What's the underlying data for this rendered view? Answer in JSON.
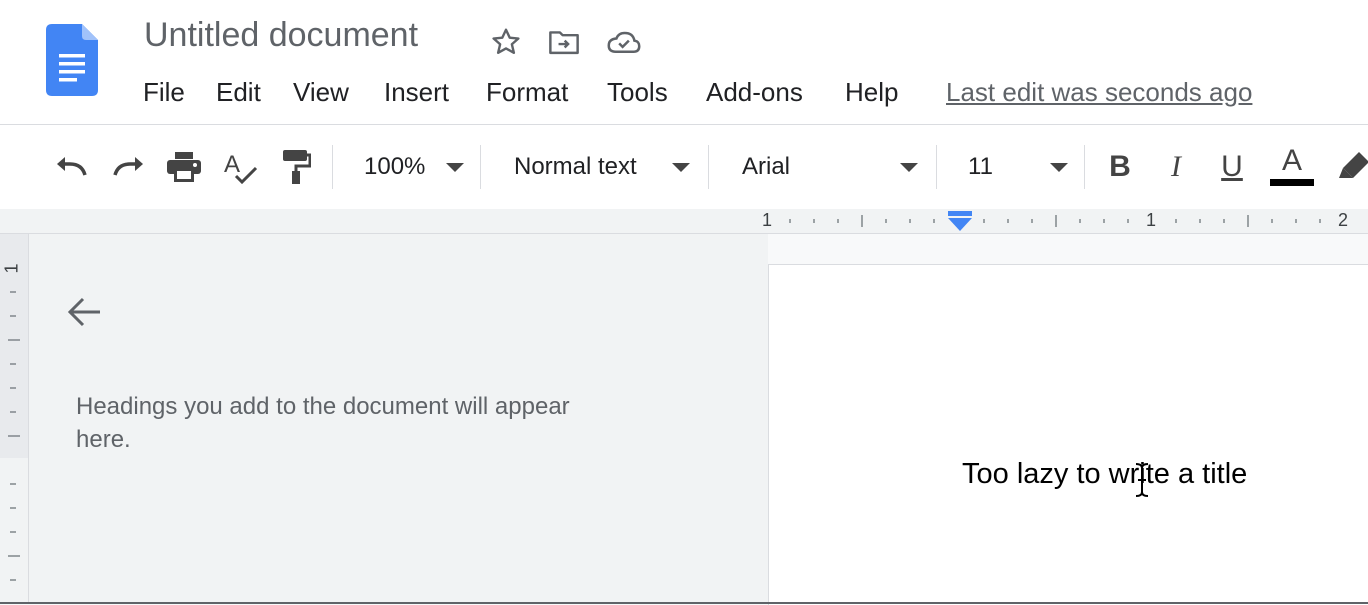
{
  "app": {
    "title": "Untitled document",
    "brand_color": "#4285f4"
  },
  "menu": {
    "items": [
      "File",
      "Edit",
      "View",
      "Insert",
      "Format",
      "Tools",
      "Add-ons",
      "Help"
    ],
    "last_edit": "Last edit was seconds ago"
  },
  "toolbar": {
    "zoom": "100%",
    "style": "Normal text",
    "font": "Arial",
    "size": "11",
    "bold_label": "B",
    "italic_label": "I",
    "underline_label": "U",
    "text_color_label": "A",
    "text_color": "#000000"
  },
  "ruler": {
    "labels": [
      "1",
      "1",
      "2"
    ],
    "vertical_label": "1",
    "indent_marker_color": "#4285f4"
  },
  "outline": {
    "empty_message": "Headings you add to the document will appear here."
  },
  "document": {
    "body_text": "Too lazy to write a title"
  },
  "icons": [
    "docs-logo-icon",
    "star-icon",
    "move-to-folder-icon",
    "cloud-saved-icon",
    "undo-icon",
    "redo-icon",
    "print-icon",
    "spellcheck-icon",
    "paint-format-icon",
    "highlighter-icon",
    "back-arrow-icon",
    "text-cursor-icon"
  ]
}
